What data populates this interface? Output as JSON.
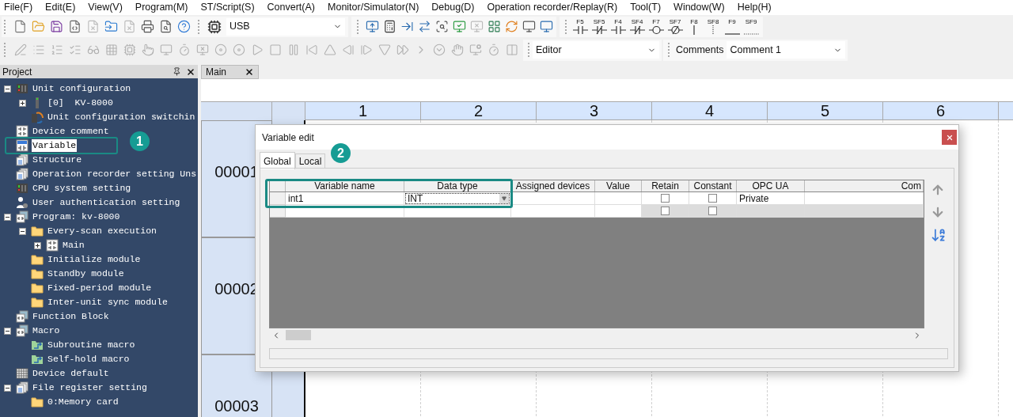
{
  "menu_bar": [
    "File(F)",
    "Edit(E)",
    "View(V)",
    "Program(M)",
    "ST/Script(S)",
    "Convert(A)",
    "Monitor/Simulator(N)",
    "Debug(D)",
    "Operation recorder/Replay(R)",
    "Tool(T)",
    "Window(W)",
    "Help(H)"
  ],
  "toolbar": {
    "connection": "USB",
    "function_keys": [
      {
        "label": "F5",
        "kind": "contact"
      },
      {
        "label": "SF5",
        "kind": "contact_nc"
      },
      {
        "label": "F4",
        "kind": "contact"
      },
      {
        "label": "SF4",
        "kind": "contact_nc"
      },
      {
        "label": "F7",
        "kind": "coil"
      },
      {
        "label": "SF7",
        "kind": "coil_neg"
      },
      {
        "label": "F8",
        "kind": "vline"
      },
      {
        "label": "SF8",
        "kind": "vline_dotted"
      },
      {
        "label": "F9",
        "kind": "hline"
      },
      {
        "label": "SF9",
        "kind": "hline_dotted"
      }
    ],
    "mode": "Editor",
    "comments_label": "Comments",
    "comment": "Comment 1"
  },
  "project_panel": {
    "title": "Project",
    "tree": [
      {
        "label": "Unit configuration",
        "kind": "rack",
        "expanded": true,
        "children": [
          {
            "label": "[0]  KV-8000",
            "kind": "unit",
            "expanded": false
          },
          {
            "label": "Unit configuration switchin",
            "kind": "switch"
          }
        ]
      },
      {
        "label": "Device comment",
        "kind": "ladder",
        "selected": false
      },
      {
        "label": "Variable",
        "kind": "variable",
        "selected": true
      },
      {
        "label": "Structure",
        "kind": "documents",
        "selected": false
      },
      {
        "label": "Operation recorder setting Uns",
        "kind": "documents",
        "selected": false
      },
      {
        "label": "CPU system setting",
        "kind": "rack",
        "selected": false
      },
      {
        "label": "User authentication setting",
        "kind": "user",
        "selected": false
      },
      {
        "label": "Program: kv-8000",
        "kind": "program",
        "expanded": true,
        "children": [
          {
            "label": "Every-scan execution",
            "kind": "folder",
            "expanded": true,
            "children": [
              {
                "label": "Main",
                "kind": "ladder",
                "expanded": false
              }
            ]
          },
          {
            "label": "Initialize module",
            "kind": "folder"
          },
          {
            "label": "Standby module",
            "kind": "folder"
          },
          {
            "label": "Fixed-period module",
            "kind": "folder"
          },
          {
            "label": "Inter-unit sync module",
            "kind": "folder"
          }
        ]
      },
      {
        "label": "Function Block",
        "kind": "program",
        "selected": false
      },
      {
        "label": "Macro",
        "kind": "program",
        "expanded": true,
        "children": [
          {
            "label": "Subroutine macro",
            "kind": "macro"
          },
          {
            "label": "Self-hold macro",
            "kind": "macro"
          }
        ]
      },
      {
        "label": "Device default",
        "kind": "grid",
        "selected": false
      },
      {
        "label": "File register setting",
        "kind": "documents",
        "expanded": true,
        "children": [
          {
            "label": "0:Memory card",
            "kind": "folder"
          }
        ]
      }
    ]
  },
  "editor": {
    "tabs": [
      {
        "label": "Main",
        "selected": true
      }
    ],
    "column_headers": [
      "1",
      "2",
      "3",
      "4",
      "5",
      "6"
    ],
    "row_labels": [
      "00001",
      "00002",
      "00003"
    ]
  },
  "dialog": {
    "title": "Variable edit",
    "tabs": [
      {
        "label": "Global",
        "selected": true
      },
      {
        "label": "Local",
        "selected": false
      }
    ],
    "columns": [
      "Variable name",
      "Data type",
      "Assigned devices",
      "Value",
      "Retain",
      "Constant",
      "OPC UA",
      "Com"
    ],
    "rows": [
      {
        "kind": "entry",
        "variable_name": "int1",
        "data_type": "INT",
        "retain": false,
        "constant": false,
        "opc_ua": "Private"
      },
      {
        "kind": "new",
        "retain": false,
        "constant": false
      }
    ]
  },
  "callouts": [
    {
      "label": "1"
    },
    {
      "label": "2"
    }
  ]
}
